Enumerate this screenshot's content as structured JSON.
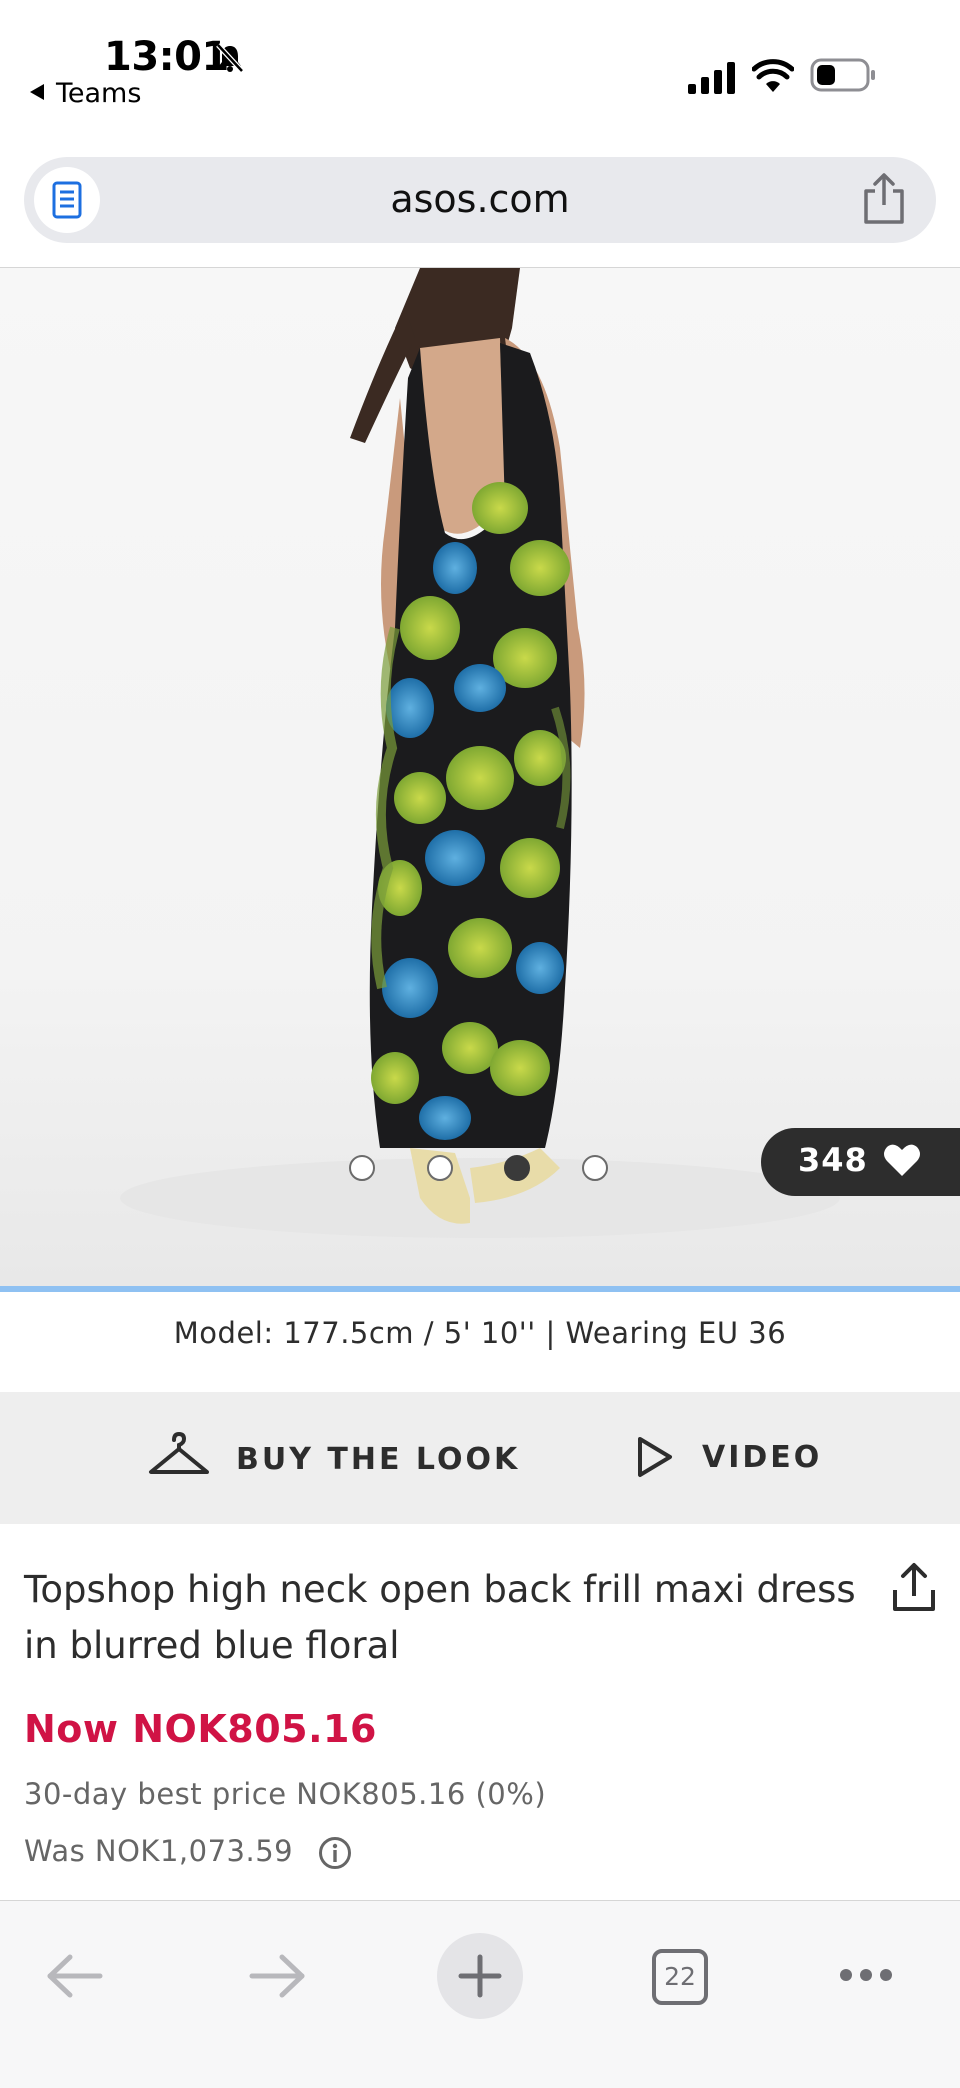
{
  "status_bar": {
    "time": "13:01",
    "back_app": "Teams"
  },
  "browser": {
    "url": "asos.com",
    "open_tabs": "22"
  },
  "product_gallery": {
    "image_count": 4,
    "active_image_index": 2,
    "save_count": "348"
  },
  "model_info": "Model: 177.5cm / 5' 10'' | Wearing EU 36",
  "actions": {
    "buy_the_look": "BUY THE LOOK",
    "video": "VIDEO"
  },
  "product": {
    "title": "Topshop high neck open back frill maxi dress in blurred blue floral",
    "price_now": "Now NOK805.16",
    "best_price": "30-day best price NOK805.16 (0%)",
    "was_price": "Was NOK1,073.59"
  },
  "colors": {
    "sale_red": "#d01345",
    "text_dark": "#2d2d2d",
    "progress_blue": "#8fc1f2"
  },
  "icons": [
    "notifications-off-icon",
    "signal-icon",
    "wifi-icon",
    "battery-icon",
    "reader-icon",
    "share-icon",
    "heart-icon",
    "hanger-icon",
    "play-icon",
    "info-icon",
    "back-arrow-icon",
    "forward-arrow-icon",
    "plus-icon",
    "more-icon"
  ]
}
